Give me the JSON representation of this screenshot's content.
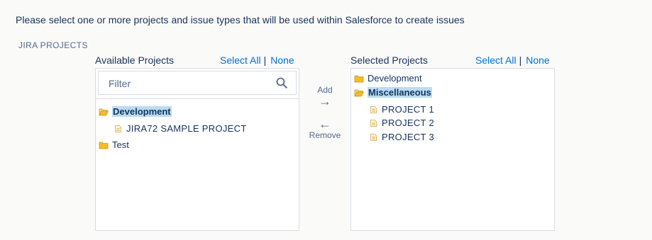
{
  "instructions": "Please select one or more projects and issue types that will be used within Salesforce to create issues",
  "section_title": "JIRA PROJECTS",
  "available": {
    "title": "Available Projects",
    "select_all": "Select All",
    "separator": "|",
    "none": "None",
    "filter_placeholder": "Filter",
    "tree": [
      {
        "label": "Development",
        "type": "folder-open",
        "selected": true
      },
      {
        "label": "JIRA72 SAMPLE PROJECT",
        "type": "project"
      },
      {
        "label": "Test",
        "type": "folder"
      }
    ]
  },
  "mover": {
    "add_label": "Add",
    "add_arrow": "→",
    "remove_arrow": "←",
    "remove_label": "Remove"
  },
  "selected": {
    "title": "Selected Projects",
    "select_all": "Select All",
    "separator": "|",
    "none": "None",
    "tree": [
      {
        "label": "Development",
        "type": "folder"
      },
      {
        "label": "Miscellaneous",
        "type": "folder-open",
        "selected": true
      },
      {
        "label": "PROJECT 1",
        "type": "project"
      },
      {
        "label": "PROJECT 2",
        "type": "project"
      },
      {
        "label": "PROJECT 3",
        "type": "project"
      }
    ]
  },
  "colors": {
    "link": "#0070d2",
    "folder": "#f4bc25",
    "highlight": "#b8dcf3",
    "text": "#16325c"
  }
}
